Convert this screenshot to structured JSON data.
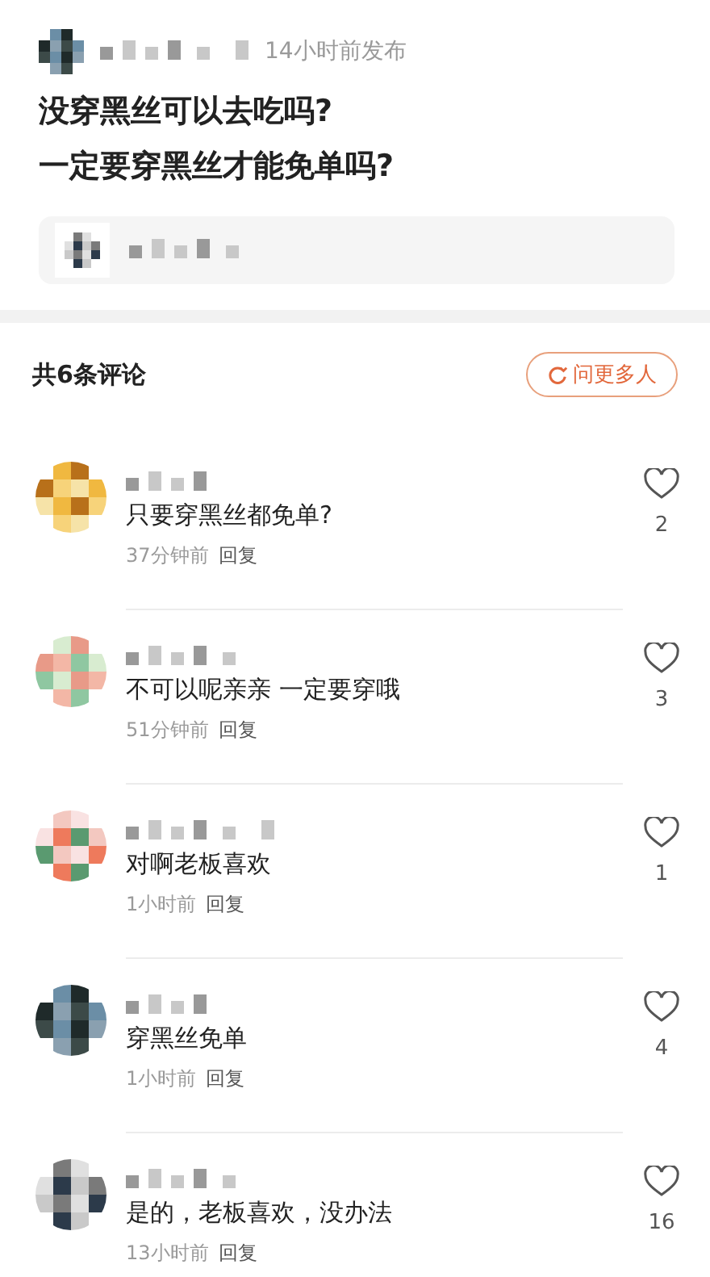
{
  "post": {
    "time": "14小时前发布",
    "title_lines": [
      "没穿黑丝可以去吃吗?",
      "一定要穿黑丝才能免单吗?"
    ]
  },
  "comments_header": {
    "count_label": "共6条评论",
    "ask_button": "问更多人"
  },
  "comments": [
    {
      "text": "只要穿黑丝都免单?",
      "time": "37分钟前",
      "reply": "回复",
      "likes": "2",
      "liked": false
    },
    {
      "text": "不可以呢亲亲 一定要穿哦",
      "time": "51分钟前",
      "reply": "回复",
      "likes": "3",
      "liked": false
    },
    {
      "text": "对啊老板喜欢",
      "time": "1小时前",
      "reply": "回复",
      "likes": "1",
      "liked": false
    },
    {
      "text": "穿黑丝免单",
      "time": "1小时前",
      "reply": "回复",
      "likes": "4",
      "liked": false
    },
    {
      "text": "是的，老板喜欢，没办法",
      "time": "13小时前",
      "reply": "回复",
      "likes": "16",
      "liked": false
    }
  ]
}
